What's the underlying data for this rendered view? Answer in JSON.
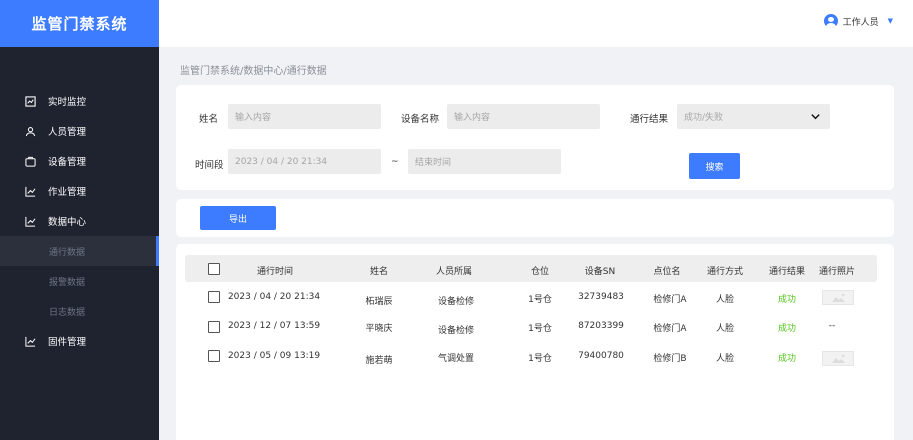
{
  "app": {
    "title": "监管门禁系统"
  },
  "header": {
    "user_label": "工作人员",
    "caret": "▼"
  },
  "sidebar": {
    "items": [
      {
        "label": "实时监控",
        "icon": "chart-icon"
      },
      {
        "label": "人员管理",
        "icon": "people-icon"
      },
      {
        "label": "设备管理",
        "icon": "device-icon"
      },
      {
        "label": "作业管理",
        "icon": "trend-icon"
      },
      {
        "label": "数据中心",
        "icon": "trend-icon"
      }
    ],
    "sub_items": [
      {
        "label": "通行数据",
        "active": true
      },
      {
        "label": "报警数据",
        "active": false
      },
      {
        "label": "日志数据",
        "active": false
      }
    ],
    "last_item": {
      "label": "固件管理",
      "icon": "trend-icon"
    }
  },
  "breadcrumb": "监管门禁系统/数据中心/通行数据",
  "filter": {
    "name_label": "姓名",
    "name_placeholder": "输入内容",
    "device_label": "设备名称",
    "device_placeholder": "输入内容",
    "result_label": "通行结果",
    "result_placeholder": "成功/失败",
    "period_label": "时间段",
    "start_value": "2023 / 04 / 20 21:34",
    "separator": "~",
    "end_placeholder": "结束时间",
    "search_label": "搜索"
  },
  "export_label": "导出",
  "table": {
    "columns": [
      "通行时间",
      "姓名",
      "人员所属",
      "仓位",
      "设备SN",
      "点位名",
      "通行方式",
      "通行结果",
      "通行照片"
    ],
    "rows": [
      {
        "time": "2023 / 04 / 20 21:34",
        "name": "柘瑞辰",
        "dept": "设备检修",
        "bay": "1号仓",
        "sn": "32739483",
        "point": "检修门A",
        "mode": "人脸",
        "result": "成功",
        "photo": true,
        "photo_text": ""
      },
      {
        "time": "2023 / 12 / 07 13:59",
        "name": "平晓庆",
        "dept": "设备检修",
        "bay": "1号仓",
        "sn": "87203399",
        "point": "检修门A",
        "mode": "人脸",
        "result": "成功",
        "photo": false,
        "photo_text": "--"
      },
      {
        "time": "2023 / 05 / 09 13:19",
        "name": "施若萌",
        "dept": "气调处置",
        "bay": "1号仓",
        "sn": "79400780",
        "point": "检修门B",
        "mode": "人脸",
        "result": "成功",
        "photo": true,
        "photo_text": ""
      }
    ]
  },
  "colors": {
    "accent": "#3d7bff",
    "sidebar": "#1f2330",
    "success": "#52c41a"
  }
}
